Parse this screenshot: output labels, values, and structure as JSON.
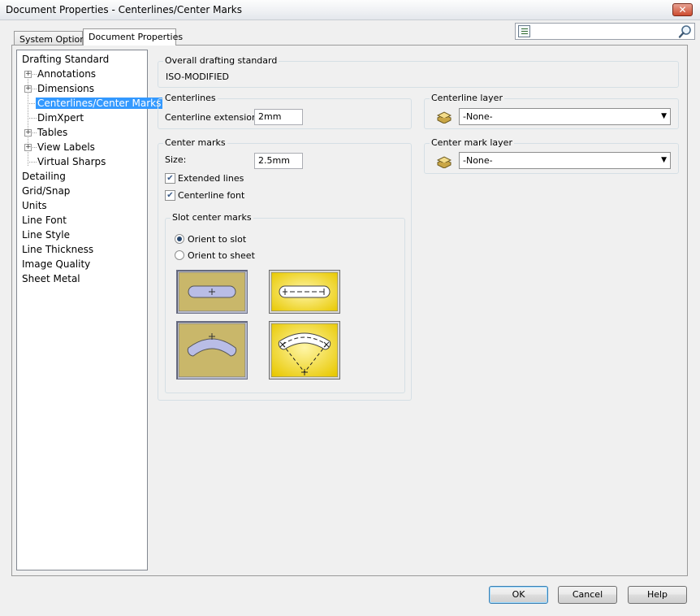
{
  "window": {
    "title": "Document Properties - Centerlines/Center Marks",
    "close_label": "✕"
  },
  "tabs": [
    {
      "label": "System Options"
    },
    {
      "label": "Document Properties"
    }
  ],
  "search": {
    "value": ""
  },
  "tree": {
    "items": [
      {
        "label": "Drafting Standard"
      },
      {
        "label": "Annotations"
      },
      {
        "label": "Dimensions"
      },
      {
        "label": "Centerlines/Center Marks"
      },
      {
        "label": "DimXpert"
      },
      {
        "label": "Tables"
      },
      {
        "label": "View Labels"
      },
      {
        "label": "Virtual Sharps"
      },
      {
        "label": "Detailing"
      },
      {
        "label": "Grid/Snap"
      },
      {
        "label": "Units"
      },
      {
        "label": "Line Font"
      },
      {
        "label": "Line Style"
      },
      {
        "label": "Line Thickness"
      },
      {
        "label": "Image Quality"
      },
      {
        "label": "Sheet Metal"
      }
    ]
  },
  "drafting_standard": {
    "title": "Overall drafting standard",
    "value": "ISO-MODIFIED"
  },
  "centerlines": {
    "title": "Centerlines",
    "extension_label": "Centerline extension:",
    "extension_value": "2mm"
  },
  "center_marks": {
    "title": "Center marks",
    "size_label": "Size:",
    "size_value": "2.5mm",
    "extended_lines_label": "Extended lines",
    "extended_lines_checked": true,
    "centerline_font_label": "Centerline font",
    "centerline_font_checked": true
  },
  "slot_center_marks": {
    "title": "Slot center marks",
    "orient_to_slot_label": "Orient to slot",
    "orient_to_sheet_label": "Orient to sheet",
    "selected": "orient_to_slot"
  },
  "centerline_layer": {
    "title": "Centerline layer",
    "value": "-None-"
  },
  "center_mark_layer": {
    "title": "Center mark layer",
    "value": "-None-"
  },
  "buttons": {
    "ok": "OK",
    "cancel": "Cancel",
    "help": "Help"
  },
  "colors": {
    "selection": "#3399ff",
    "slot_tan": "#c9b76a",
    "slot_yellow": "#f2d81c",
    "slot_shape": "#b9bde6"
  }
}
